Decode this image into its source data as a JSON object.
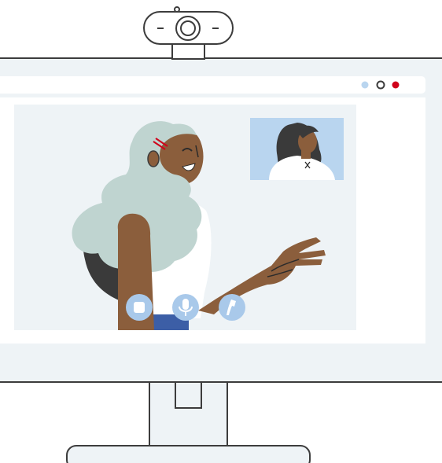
{
  "colors": {
    "monitor_fill": "#eef3f6",
    "outline": "#3c3c3c",
    "window_bg": "#ffffff",
    "video_bg": "#eef3f6",
    "pip_bg": "#b9d5ef",
    "hair_main": "#bfd4d0",
    "skin_main": "#8b5e3c",
    "hair_dark": "#3a3a3a",
    "shirt": "#ffffff",
    "pants": "#3c5ea6",
    "control_button": "#a9c9ea",
    "dot_light": "#b9d5ef",
    "dot_red": "#d0021b"
  },
  "icons": {
    "camera": "webcam-icon",
    "stop": "stop-icon",
    "mic": "microphone-icon",
    "call": "phone-icon"
  },
  "controls": [
    {
      "name": "stop-video-button",
      "icon": "stop-icon"
    },
    {
      "name": "mute-button",
      "icon": "microphone-icon"
    },
    {
      "name": "end-call-button",
      "icon": "phone-icon"
    }
  ]
}
